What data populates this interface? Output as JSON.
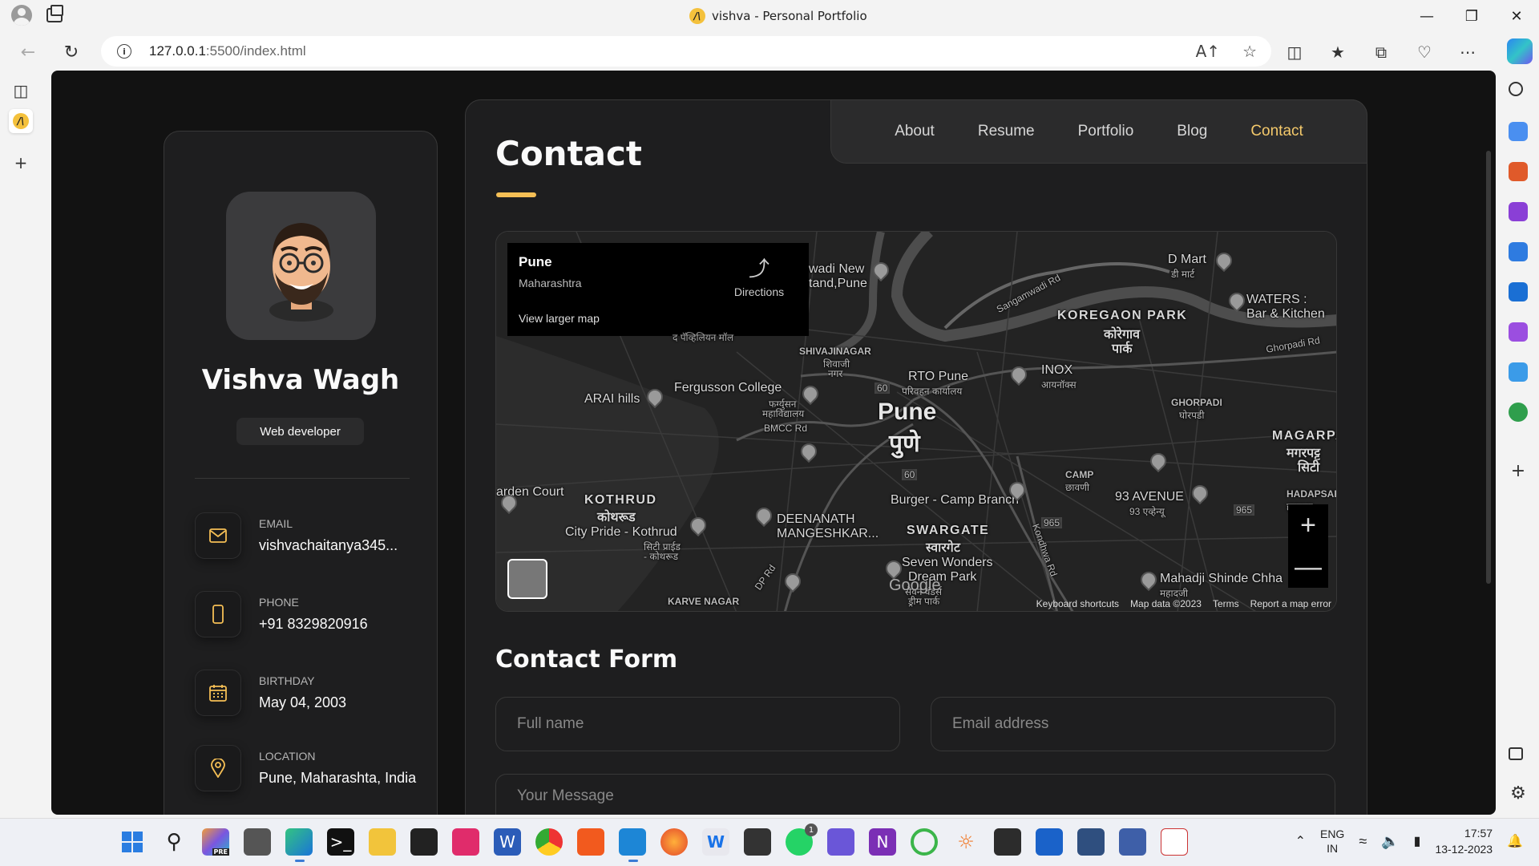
{
  "browser": {
    "tab_title": "vishva - Personal Portfolio",
    "favicon_letter": "/\\",
    "url_host": "127.0.0.1",
    "url_rest": ":5500/index.html"
  },
  "sidebar": {
    "name": "Vishva Wagh",
    "role": "Web developer",
    "contacts": [
      {
        "label": "Email",
        "value": "vishvachaitanya345...",
        "icon": "mail-icon"
      },
      {
        "label": "Phone",
        "value": "+91 8329820916",
        "icon": "phone-icon"
      },
      {
        "label": "Birthday",
        "value": "May 04, 2003",
        "icon": "calendar-icon"
      },
      {
        "label": "Location",
        "value": "Pune, Maharashta, India",
        "icon": "location-pin-icon"
      }
    ]
  },
  "nav": {
    "items": [
      "About",
      "Resume",
      "Portfolio",
      "Blog",
      "Contact"
    ],
    "active": "Contact"
  },
  "page": {
    "title": "Contact",
    "form_title": "Contact Form",
    "accent": "#f5bf55"
  },
  "map": {
    "card_city": "Pune",
    "card_state": "Maharashtra",
    "directions": "Directions",
    "view_larger": "View larger map",
    "center_en": "Pune",
    "center_mr": "पुणे",
    "labels": {
      "wadi": "wadi New",
      "stand": "tand,Pune",
      "dmart": "D Mart",
      "dmart_mr": "डी मार्ट",
      "koregaon": "KOREGAON PARK",
      "koregaon_mr": "कोरेगाव",
      "koregaon_mr2": "पार्क",
      "waters": "WATERS :",
      "waters2": "Bar & Kitchen",
      "ghorpadi_rd": "Ghorpadi Rd",
      "sangamwadi": "Sangamwadi Rd",
      "shivajinagar": "SHIVAJINAGAR",
      "shivajinagar_mr": "शिवाजी",
      "shivajinagar_mr2": "नगर",
      "fergusson": "Fergusson College",
      "fergusson_mr": "फर्ग्युसन",
      "fergusson_mr2": "महाविद्यालय",
      "rto": "RTO Pune",
      "rto_mr": "परिवहन कार्यालय",
      "inox": "INOX",
      "inox_mr": "आयनॉक्स",
      "arai": "ARAI hills",
      "bmcc": "BMCC Rd",
      "ghorpadi": "GHORPADI",
      "ghorpadi_mr": "घोरपडी",
      "magarpatta": "MAGARPA",
      "magarpatta_mr": "मगरपट्ट",
      "magarpatta_mr2": "सिटी",
      "garden_court": "arden Court",
      "kothrud": "KOTHRUD",
      "kothrud_mr": "कोथरूड",
      "camp": "CAMP",
      "camp_mr": "छावणी",
      "burger": "Burger - Camp Branch",
      "avenue": "93 AVENUE",
      "avenue_mr": "93 एव्हेन्यू",
      "hadapsar": "HADAPSAR",
      "hadapsar_mr": "हडपसर",
      "citypride": "City Pride - Kothrud",
      "citypride_mr": "सिटी प्राईड",
      "citypride_mr2": "- कोथरूड",
      "deenanath": "DEENANATH",
      "mangeshkar": "MANGESHKAR...",
      "swargate": "SWARGATE",
      "swargate_mr": "स्वारगेट",
      "sevenwonders": "Seven Wonders",
      "dreampark": "Dream Park",
      "dreampark_mr": "सेवन वंडर्स",
      "dreampark_mr2": "ड्रीम पार्क",
      "mahadji": "Mahadji Shinde Chha",
      "mahadji_mr": "महादजी",
      "karvenagar": "KARVE NAGAR",
      "dprd": "DP Rd",
      "kondhwa": "Kondhwa Rd",
      "rd60a": "60",
      "rd60b": "60",
      "rd965a": "965",
      "rd965b": "965",
      "pavilion": "द पॅव्हिलियन मॉल"
    },
    "footer": [
      "Keyboard shortcuts",
      "Map data ©2023",
      "Terms",
      "Report a map error"
    ],
    "google": "Google"
  },
  "form": {
    "fullname_placeholder": "Full name",
    "email_placeholder": "Email address",
    "message_placeholder": "Your Message"
  },
  "taskbar": {
    "lang1": "ENG",
    "lang2": "IN",
    "time": "17:57",
    "date": "13-12-2023",
    "whatsapp_badge": "1",
    "copilot_badge": "PRE"
  }
}
